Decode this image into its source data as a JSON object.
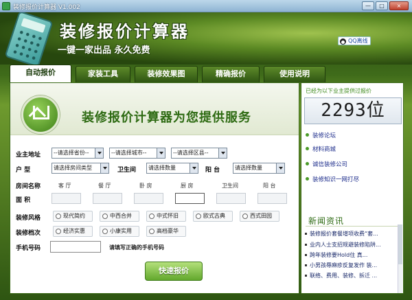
{
  "window": {
    "title": "装修报价计算器 V1.002",
    "minimize": "—",
    "maximize": "□",
    "close": "×"
  },
  "header": {
    "title": "装修报价计算器",
    "slogan": "一键一家出品 永久免费",
    "qq_label": "QQ离线"
  },
  "tabs": [
    {
      "label": "自动报价"
    },
    {
      "label": "家装工具"
    },
    {
      "label": "装修效果图"
    },
    {
      "label": "精确报价"
    },
    {
      "label": "使用说明"
    }
  ],
  "banner": {
    "slogan": "装修报价计算器为您提供服务"
  },
  "form": {
    "address_label": "业主地址",
    "province": "--请选择省份--",
    "city": "--请选择城市--",
    "district": "--请选择区县--",
    "house_type_label": "户 型",
    "house_type": "请选择房间类型",
    "bathroom_label": "卫生间",
    "bathroom": "请选择数量",
    "balcony_label": "阳 台",
    "balcony": "请选择数量",
    "room_name_label": "房间名称",
    "rooms": [
      "客 厅",
      "餐 厅",
      "卧 房",
      "厨 房",
      "卫生间",
      "阳 台"
    ],
    "area_label": "面 积",
    "style_label": "装修风格",
    "styles": [
      "现代简约",
      "中西合并",
      "中式怀旧",
      "欧式古典",
      "西式田园"
    ],
    "grade_label": "装修档次",
    "grades": [
      "经济实惠",
      "小康实用",
      "高档豪华"
    ],
    "phone_label": "手机号码",
    "phone_value": "",
    "phone_hint": "请填写正确的手机号码",
    "submit_label": "快速报价"
  },
  "sidebar": {
    "users_label": "已经为以下业主提供过报价",
    "counter": "2293位",
    "links": [
      "装修论坛",
      "材料商城",
      "诚信装修公司",
      "装修知识一网打尽"
    ],
    "news_title": "新闻资讯",
    "news": [
      "装修报价套餐增项收费“套...",
      "业内人士支招规避装修陷阱...",
      "跨年装修要Hold住 真...",
      "小男孩辱麻疹反复发作 装...",
      "联络、费用、装修、拆迁 ..."
    ]
  },
  "colors": {
    "accent_green": "#2d6a12",
    "link_blue": "#1a2a8a",
    "button_green": "#62a82c"
  }
}
